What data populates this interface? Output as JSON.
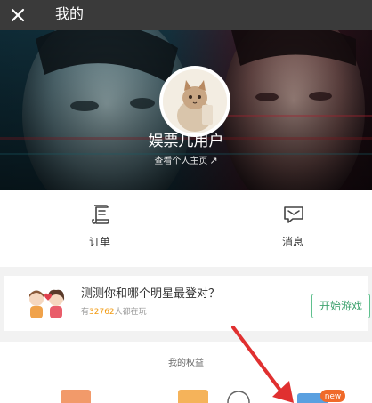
{
  "topbar": {
    "title": "我的"
  },
  "profile": {
    "username": "娱票儿用户",
    "homepage_link": "查看个人主页",
    "homepage_arrow": "↗"
  },
  "actions": {
    "orders_label": "订单",
    "messages_label": "消息"
  },
  "game": {
    "title": "测测你和哪个明星最登对？",
    "count_prefix": "有",
    "count_value": "32762",
    "count_suffix": "人都在玩",
    "button_label": "开始游戏"
  },
  "benefits": {
    "title": "我的权益",
    "badge_new": "new"
  },
  "colors": {
    "topbar": "#3a3a3a",
    "play_button_border": "#5fc08e",
    "play_button_text": "#3fa36f",
    "count_highlight": "#f29b12",
    "annotation_arrow": "#e03030"
  },
  "icons": [
    "close-icon",
    "orders-icon",
    "messages-icon",
    "share-arrow-icon",
    "couple-illustration",
    "benefit-icon"
  ]
}
